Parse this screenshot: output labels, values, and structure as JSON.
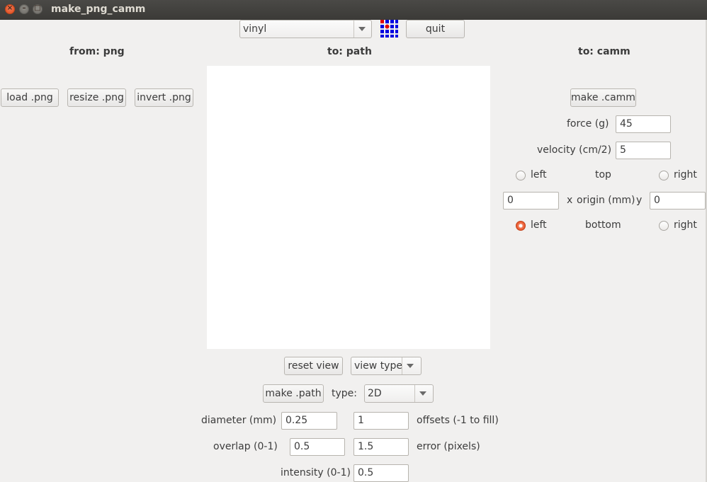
{
  "window": {
    "title": "make_png_camm"
  },
  "toolbar": {
    "machine_selected": "vinyl",
    "quit_label": "quit",
    "logo_icon": "fab-logo-icon"
  },
  "columns": {
    "from_label": "from: png",
    "path_label": "to: path",
    "camm_label": "to: camm"
  },
  "png": {
    "load_label": "load .png",
    "resize_label": "resize .png",
    "invert_label": "invert .png"
  },
  "camm": {
    "make_label": "make .camm",
    "force_label": "force (g)",
    "force_value": "45",
    "velocity_label": "velocity (cm/2)",
    "velocity_value": "5",
    "top_left_label": "left",
    "top_label": "top",
    "top_right_label": "right",
    "origin_x_value": "0",
    "x_label": "x",
    "origin_label": "origin (mm)",
    "y_label": "y",
    "origin_y_value": "0",
    "bottom_left_label": "left",
    "bottom_label": "bottom",
    "bottom_right_label": "right",
    "selected_origin": "bottom-left"
  },
  "path": {
    "reset_view_label": "reset view",
    "view_type_label": "view type",
    "make_path_label": "make .path",
    "type_label": "type:",
    "type_value": "2D",
    "diameter_label": "diameter (mm)",
    "diameter_value": "0.25",
    "offsets_value": "1",
    "offsets_label": "offsets (-1 to fill)",
    "overlap_label": "overlap (0-1)",
    "overlap_value": "0.5",
    "error_value": "1.5",
    "error_label": "error (pixels)",
    "intensity_label": "intensity (0-1)",
    "intensity_value": "0.5"
  },
  "colors": {
    "accent": "#e9552a",
    "titlebar": "#3c3b37",
    "logo_red": "#e00000",
    "logo_blue": "#0000e0"
  }
}
